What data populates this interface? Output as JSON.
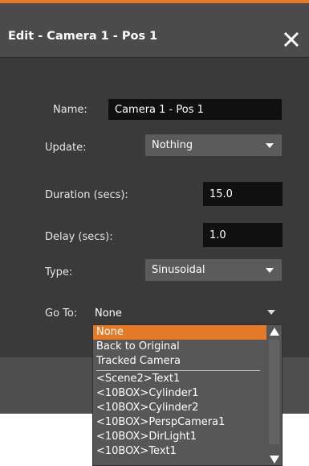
{
  "dialog": {
    "title": "Edit - Camera 1 - Pos 1",
    "accent_color": "#e47a28"
  },
  "form": {
    "name_label": "Name:",
    "name_value": "Camera 1 - Pos 1",
    "update_label": "Update:",
    "update_value": "Nothing",
    "duration_label": "Duration (secs):",
    "duration_value": "15.0",
    "delay_label": "Delay (secs):",
    "delay_value": "1.0",
    "type_label": "Type:",
    "type_value": "Sinusoidal",
    "goto_label": "Go To:",
    "goto_value": "None"
  },
  "goto_options": {
    "items": [
      "None",
      "Back to Original",
      "Tracked Camera",
      "<Scene2>Text1",
      "<10BOX>Cylinder1",
      "<10BOX>Cylinder2",
      "<10BOX>PerspCamera1",
      "<10BOX>DirLight1",
      "<10BOX>Text1"
    ],
    "selected": "None"
  },
  "icons": {
    "close": "close-icon",
    "dropdown": "chevron-down-icon",
    "scroll_up": "arrow-up-icon",
    "scroll_down": "arrow-down-icon"
  }
}
